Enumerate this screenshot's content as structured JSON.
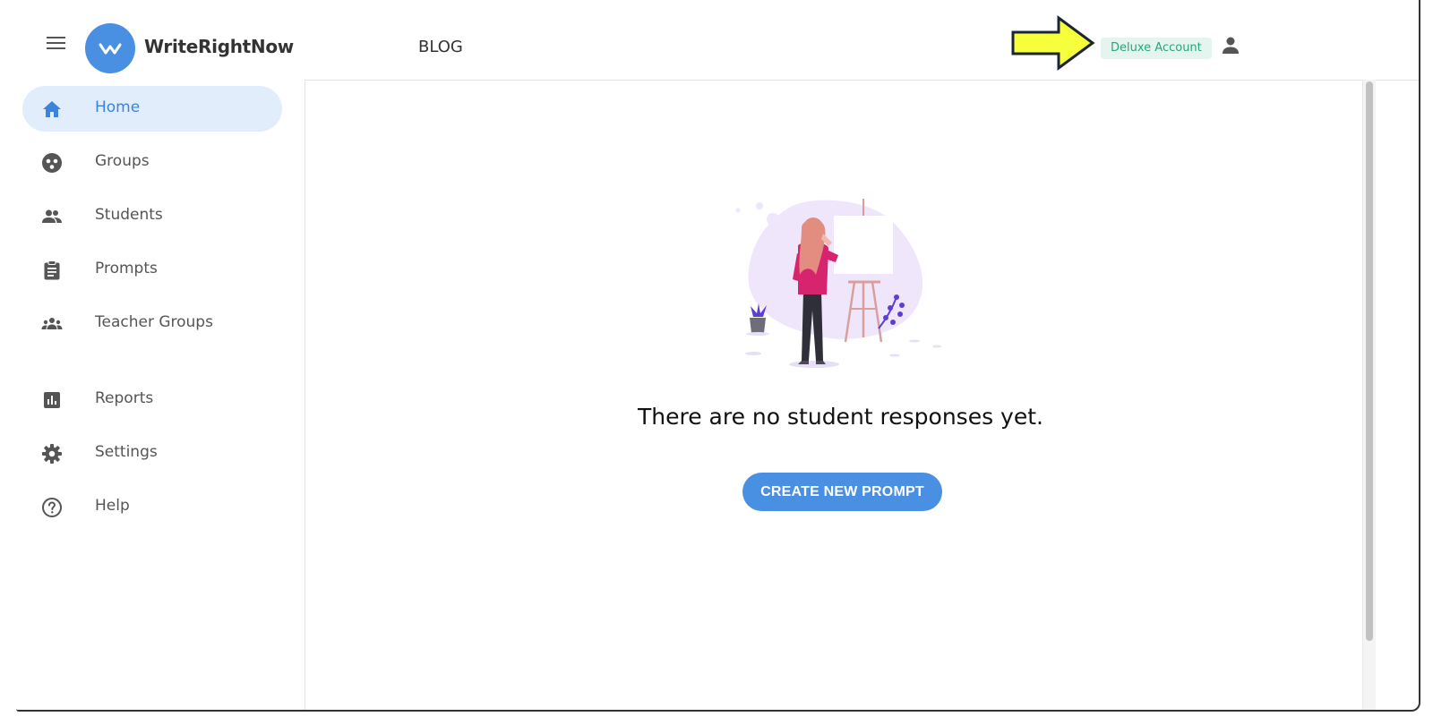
{
  "header": {
    "app_name": "WriteRightNow",
    "blog_label": "BLOG",
    "account_badge": "Deluxe Account"
  },
  "sidebar": {
    "items": [
      {
        "label": "Home",
        "icon": "home-icon",
        "active": true
      },
      {
        "label": "Groups",
        "icon": "groups-icon"
      },
      {
        "label": "Students",
        "icon": "students-icon"
      },
      {
        "label": "Prompts",
        "icon": "clipboard-icon"
      },
      {
        "label": "Teacher Groups",
        "icon": "teacher-groups-icon"
      },
      {
        "label": "Reports",
        "icon": "reports-icon"
      },
      {
        "label": "Settings",
        "icon": "gear-icon"
      },
      {
        "label": "Help",
        "icon": "help-icon"
      }
    ]
  },
  "main": {
    "empty_message": "There are no student responses yet.",
    "create_button_label": "CREATE NEW PROMPT"
  },
  "colors": {
    "brand_blue": "#4a90e2",
    "active_bg": "#e1edfb",
    "badge_bg": "#e3f5ee",
    "badge_text": "#2aa57a",
    "annotation_arrow": "#f7ff3c"
  }
}
